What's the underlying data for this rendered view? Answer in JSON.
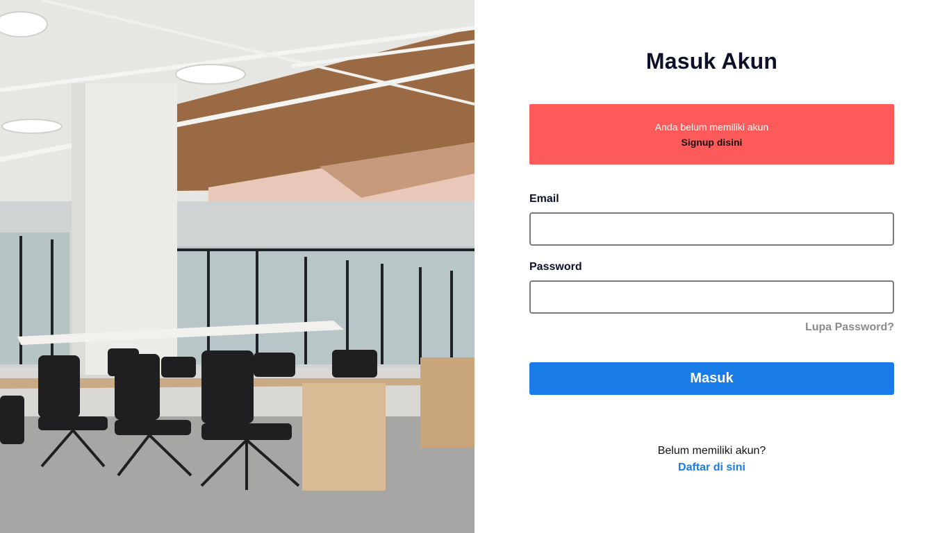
{
  "page": {
    "title": "Masuk Akun"
  },
  "alert": {
    "message": "Anda belum memiliki akun",
    "link_label": "Signup disini",
    "color": "#fe5a5a"
  },
  "form": {
    "email_label": "Email",
    "email_value": "",
    "password_label": "Password",
    "password_value": "",
    "forgot_label": "Lupa Password?",
    "submit_label": "Masuk",
    "accent_color": "#1a7ce8"
  },
  "footer": {
    "question": "Belum memiliki akun?",
    "link_label": "Daftar di sini"
  }
}
